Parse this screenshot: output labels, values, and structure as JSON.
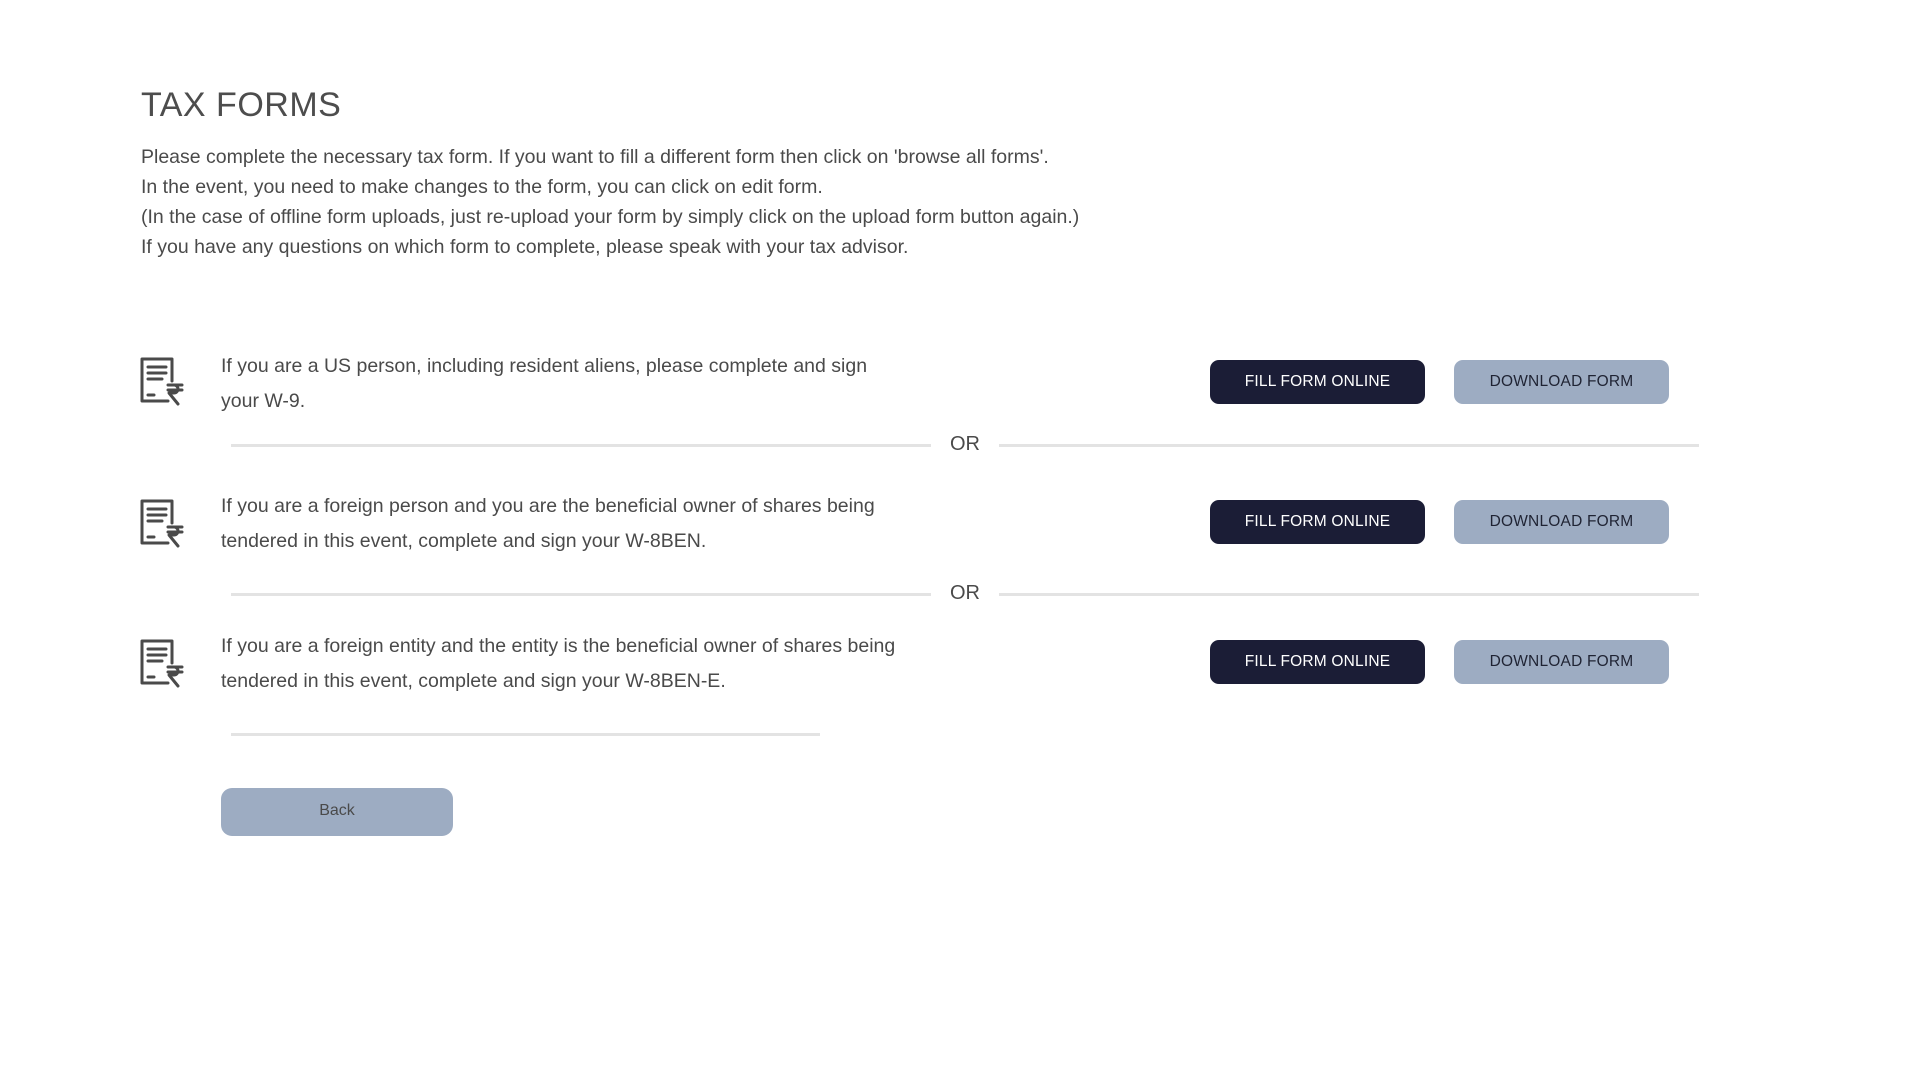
{
  "page": {
    "title": "TAX FORMS",
    "intro_lines": [
      "Please complete the necessary tax form. If you want to fill a different form then click on 'browse all forms'.",
      "In the event, you need to make changes to the form, you can click on edit form.",
      "(In the case of offline form uploads, just re-upload your form by simply click on the upload form button again.)",
      "If you have any questions on which form to complete, please speak with your tax advisor."
    ]
  },
  "forms": [
    {
      "icon": "tax-document-icon",
      "description": "If you are a US person, including resident aliens, please complete and sign your W-9.",
      "fill_label": "FILL FORM ONLINE",
      "download_label": "DOWNLOAD FORM"
    },
    {
      "icon": "tax-document-icon",
      "description": "If you are a foreign person and you are the beneficial owner of shares being tendered in this event, complete and sign your W-8BEN.",
      "fill_label": "FILL FORM ONLINE",
      "download_label": "DOWNLOAD FORM"
    },
    {
      "icon": "tax-document-icon",
      "description": "If you are a foreign entity and the entity is the beneficial owner of shares being tendered in this event, complete and sign your W-8BEN-E.",
      "fill_label": "FILL FORM ONLINE",
      "download_label": "DOWNLOAD FORM"
    }
  ],
  "separators": {
    "or_label": "OR"
  },
  "actions": {
    "back_label": "Back"
  },
  "colors": {
    "primary_button": "#1b1d36",
    "secondary_button": "#9dacc2",
    "divider": "#e3e3e3",
    "text": "#4a4a4a"
  }
}
